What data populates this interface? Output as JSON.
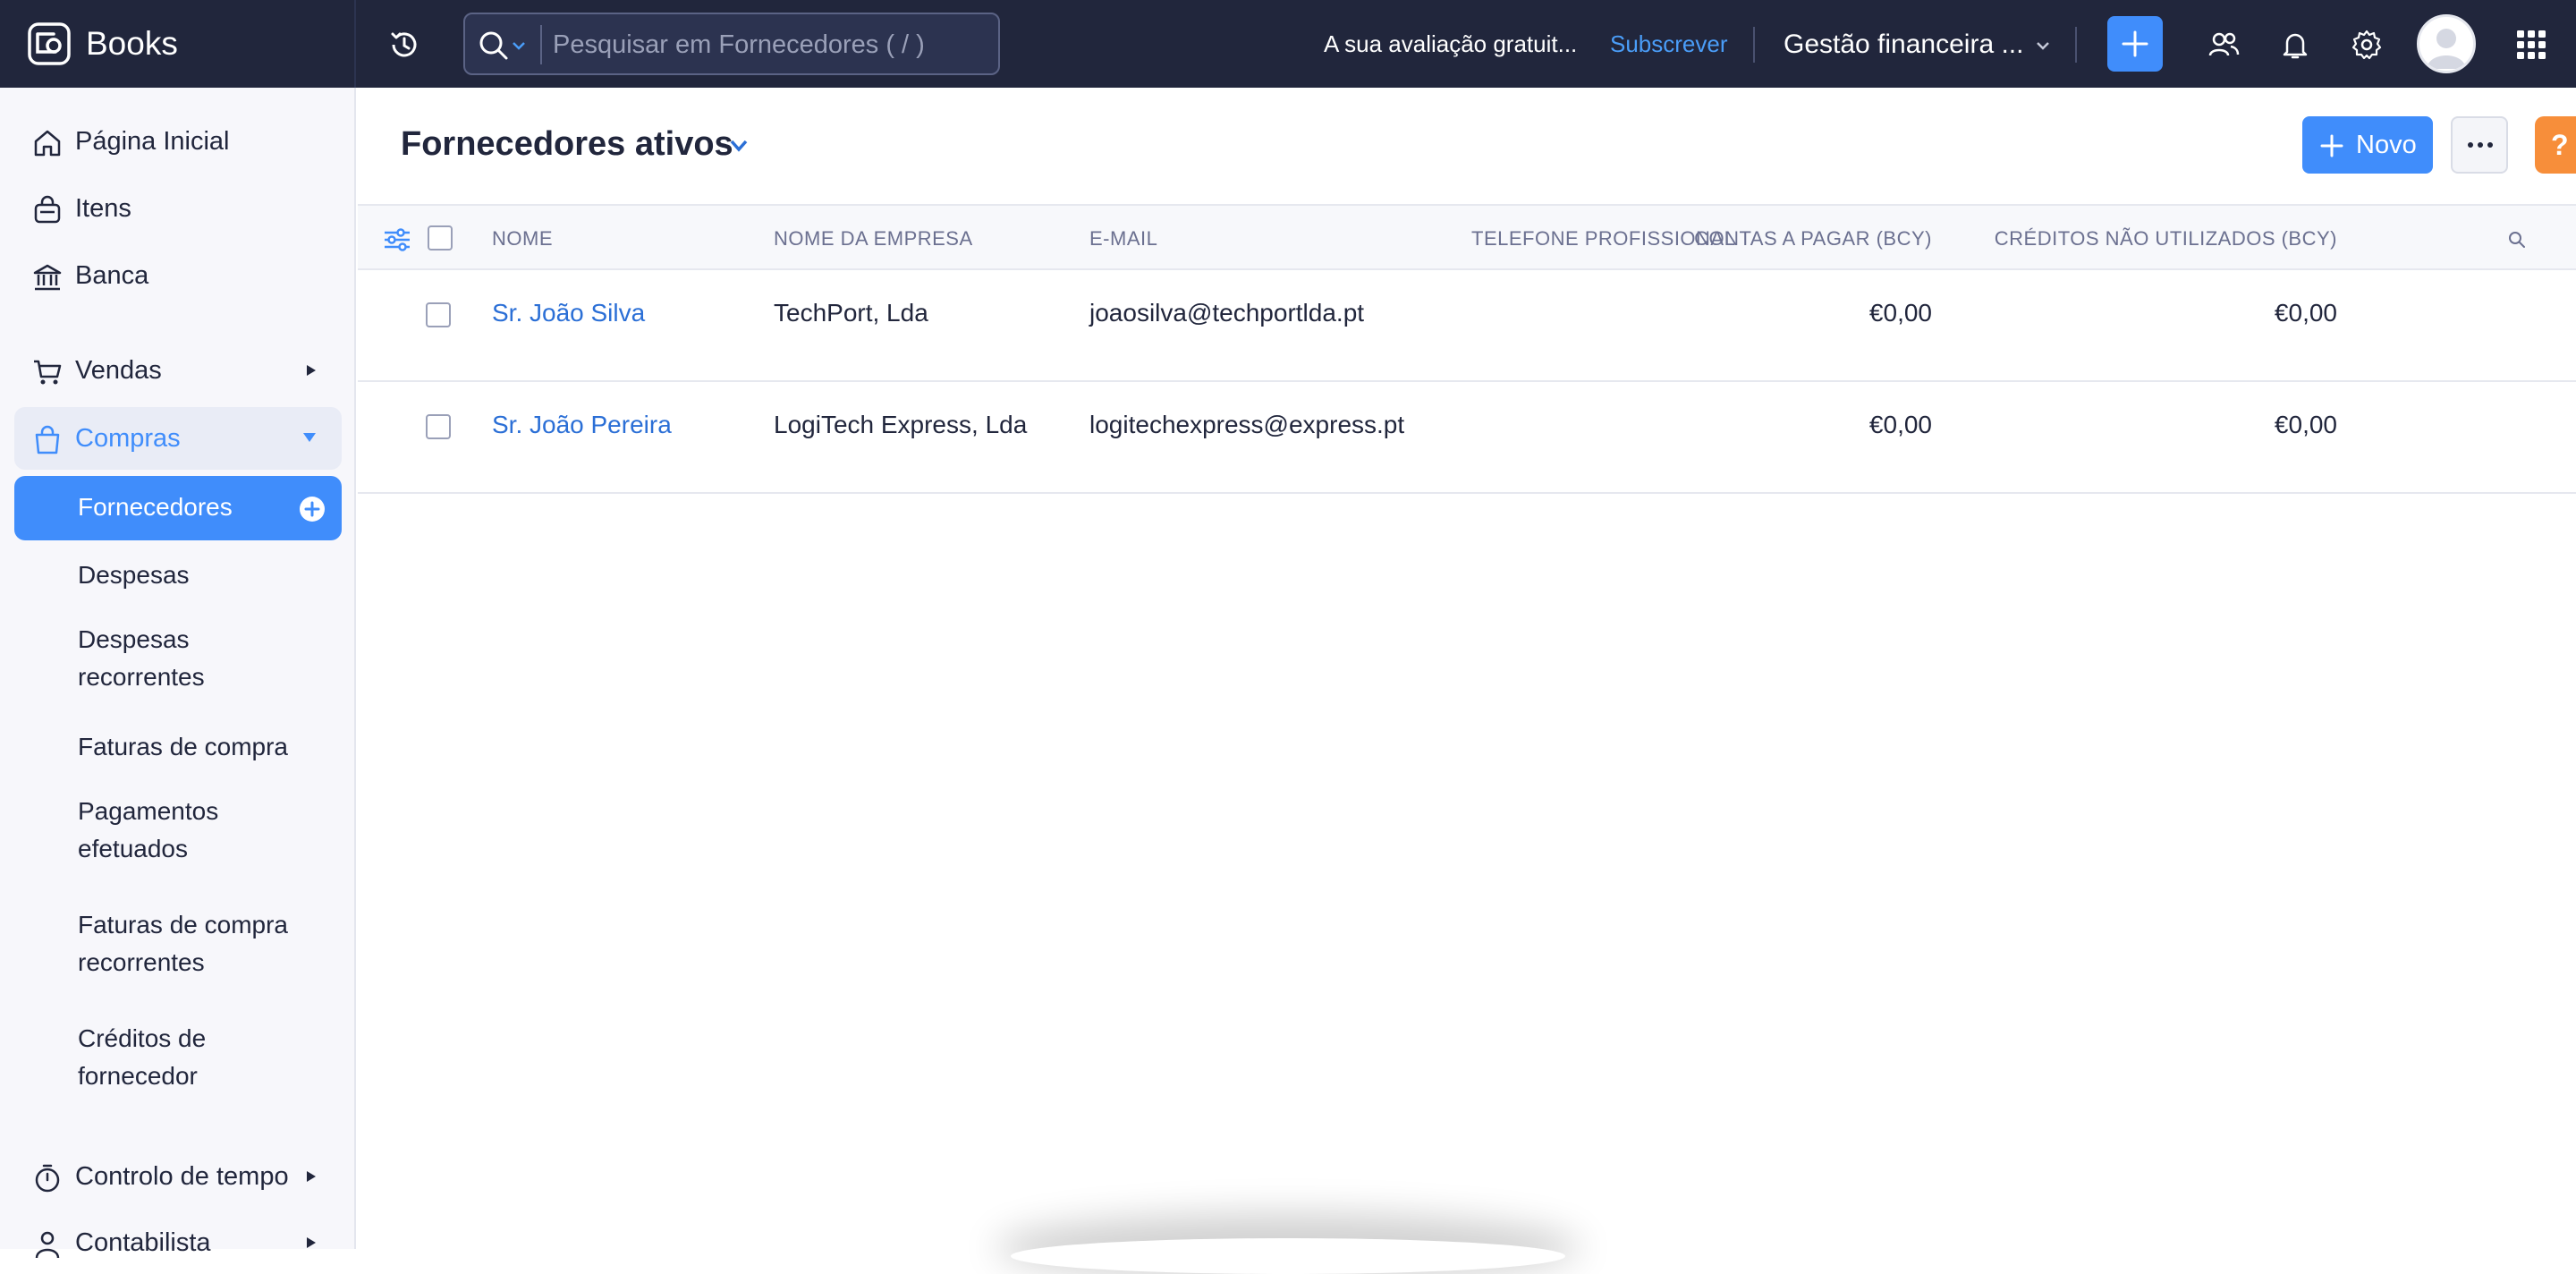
{
  "app": {
    "name": "Books"
  },
  "topbar": {
    "search_placeholder": "Pesquisar em Fornecedores ( / )",
    "trial_text": "A sua avaliação gratuit...",
    "subscribe_label": "Subscrever",
    "org_name": "Gestão financeira ..."
  },
  "sidebar": {
    "items": [
      {
        "label": "Página Inicial",
        "icon": "home-icon"
      },
      {
        "label": "Itens",
        "icon": "shopping-bag-icon"
      },
      {
        "label": "Banca",
        "icon": "bank-icon"
      },
      {
        "label": "Vendas",
        "icon": "cart-icon"
      },
      {
        "label": "Compras",
        "icon": "purchase-bag-icon"
      },
      {
        "label": "Controlo de tempo",
        "icon": "stopwatch-icon"
      },
      {
        "label": "Contabilista",
        "icon": "user-icon"
      }
    ],
    "purchases_sub": [
      {
        "label": "Fornecedores"
      },
      {
        "label": "Despesas"
      },
      {
        "label": "Despesas recorrentes",
        "line1": "Despesas",
        "line2": "recorrentes"
      },
      {
        "label": "Faturas de compra"
      },
      {
        "label": "Pagamentos efetuados",
        "line1": "Pagamentos",
        "line2": "efetuados"
      },
      {
        "label": "Faturas de compra recorrentes",
        "line1": "Faturas de compra",
        "line2": "recorrentes"
      },
      {
        "label": "Créditos de fornecedor",
        "line1": "Créditos de",
        "line2": "fornecedor"
      }
    ]
  },
  "main": {
    "view_title": "Fornecedores ativos",
    "new_button_label": "Novo",
    "help_label": "?",
    "columns": [
      "NOME",
      "NOME DA EMPRESA",
      "E-MAIL",
      "TELEFONE PROFISSIONAL",
      "CONTAS A PAGAR (BCY)",
      "CRÉDITOS NÃO UTILIZADOS (BCY)"
    ],
    "rows": [
      {
        "name": "Sr. João Silva",
        "company": "TechPort, Lda",
        "email": "joaosilva@techportlda.pt",
        "phone": "",
        "payables": "€0,00",
        "credits": "€0,00"
      },
      {
        "name": "Sr. João Pereira",
        "company": "LogiTech Express, Lda",
        "email": "logitechexpress@express.pt",
        "phone": "",
        "payables": "€0,00",
        "credits": "€0,00"
      }
    ]
  },
  "colors": {
    "topbar": "#21263c",
    "accent": "#408dfb",
    "help": "#f78e3a",
    "sidebar_bg": "#f7f7fb"
  }
}
